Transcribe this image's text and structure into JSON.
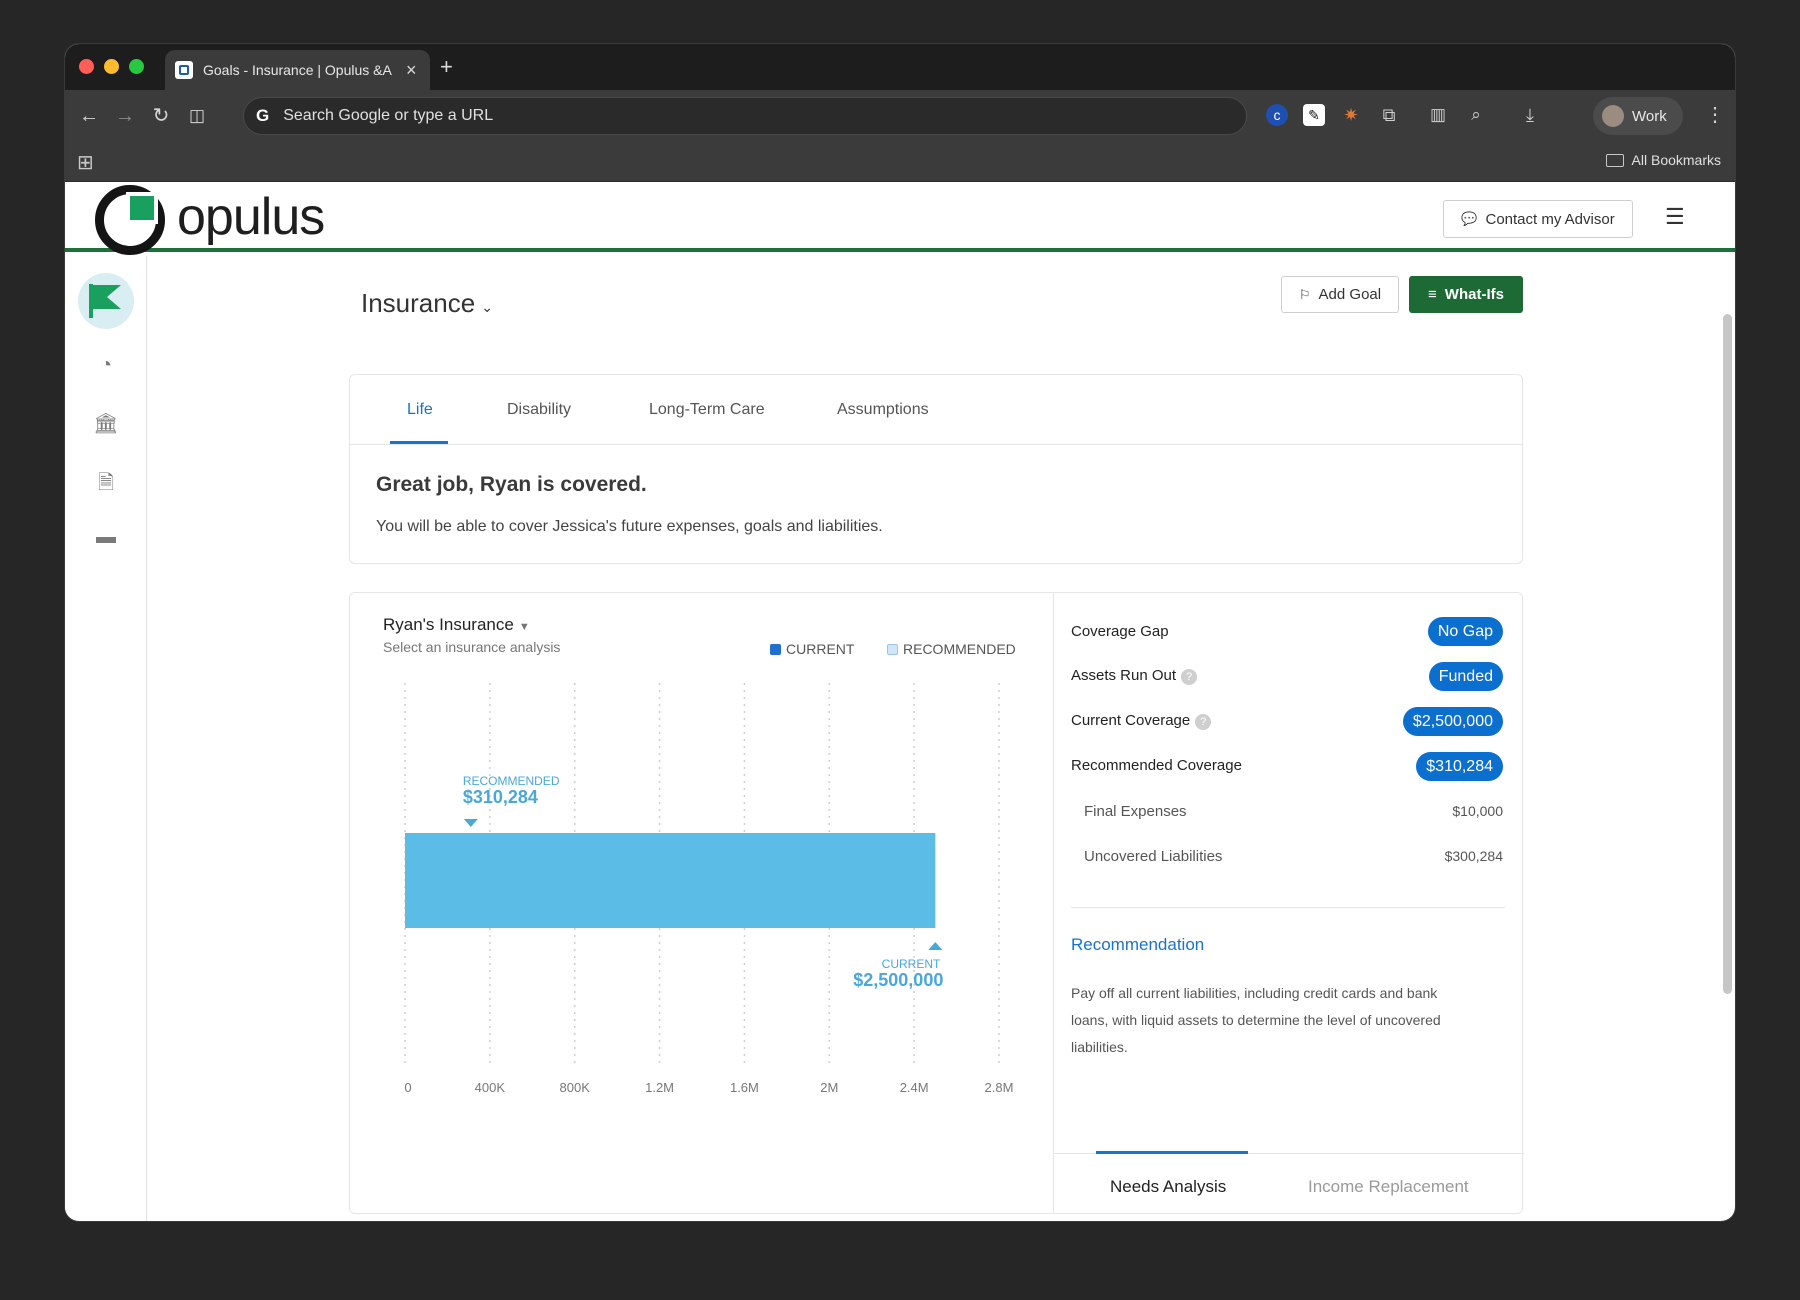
{
  "browser": {
    "tab_title": "Goals - Insurance | Opulus &A",
    "address_placeholder": "Search Google or type a URL",
    "profile_name": "Work",
    "bookmarks_label": "All Bookmarks"
  },
  "header": {
    "logo_text": "opulus",
    "contact_label": "Contact my Advisor"
  },
  "page": {
    "goal_title": "Insurance",
    "add_goal_label": "Add Goal",
    "whatifs_label": "What-Ifs"
  },
  "tabs": [
    {
      "label": "Life"
    },
    {
      "label": "Disability"
    },
    {
      "label": "Long-Term Care"
    },
    {
      "label": "Assumptions"
    }
  ],
  "summary": {
    "title": "Great job, Ryan is covered.",
    "subtitle": "You will be able to cover Jessica's future expenses, goals and liabilities."
  },
  "analysis": {
    "title": "Ryan's Insurance",
    "subtitle": "Select an insurance analysis"
  },
  "chart_data": {
    "type": "bar",
    "orientation": "horizontal",
    "legend": [
      "CURRENT",
      "RECOMMENDED"
    ],
    "legend_position": "top-right",
    "x_ticks": [
      "0",
      "400K",
      "800K",
      "1.2M",
      "1.6M",
      "2M",
      "2.4M",
      "2.8M"
    ],
    "xlim": [
      0,
      2800000
    ],
    "grid": true,
    "series": [
      {
        "name": "CURRENT",
        "value": 2500000,
        "label_title": "CURRENT",
        "label_value": "$2,500,000"
      },
      {
        "name": "RECOMMENDED",
        "value": 310284,
        "label_title": "RECOMMENDED",
        "label_value": "$310,284"
      }
    ],
    "colors": {
      "current": "#5bbde6",
      "marker": "#4aa8d8",
      "legend_current": "#1f6fce",
      "legend_recommended": "#cfe6f7"
    }
  },
  "metrics": {
    "coverage_gap_label": "Coverage Gap",
    "coverage_gap_value": "No Gap",
    "assets_run_out_label": "Assets Run Out",
    "assets_run_out_value": "Funded",
    "current_coverage_label": "Current Coverage",
    "current_coverage_value": "$2,500,000",
    "recommended_coverage_label": "Recommended Coverage",
    "recommended_coverage_value": "$310,284",
    "final_expenses_label": "Final Expenses",
    "final_expenses_value": "$10,000",
    "uncovered_liabilities_label": "Uncovered Liabilities",
    "uncovered_liabilities_value": "$300,284"
  },
  "recommendation": {
    "title": "Recommendation",
    "line1": "Pay off all current liabilities, including credit cards and bank",
    "line2": "loans, with liquid assets to determine the level of uncovered",
    "line3": "liabilities."
  },
  "bottom_tabs": {
    "needs": "Needs Analysis",
    "income": "Income Replacement"
  }
}
